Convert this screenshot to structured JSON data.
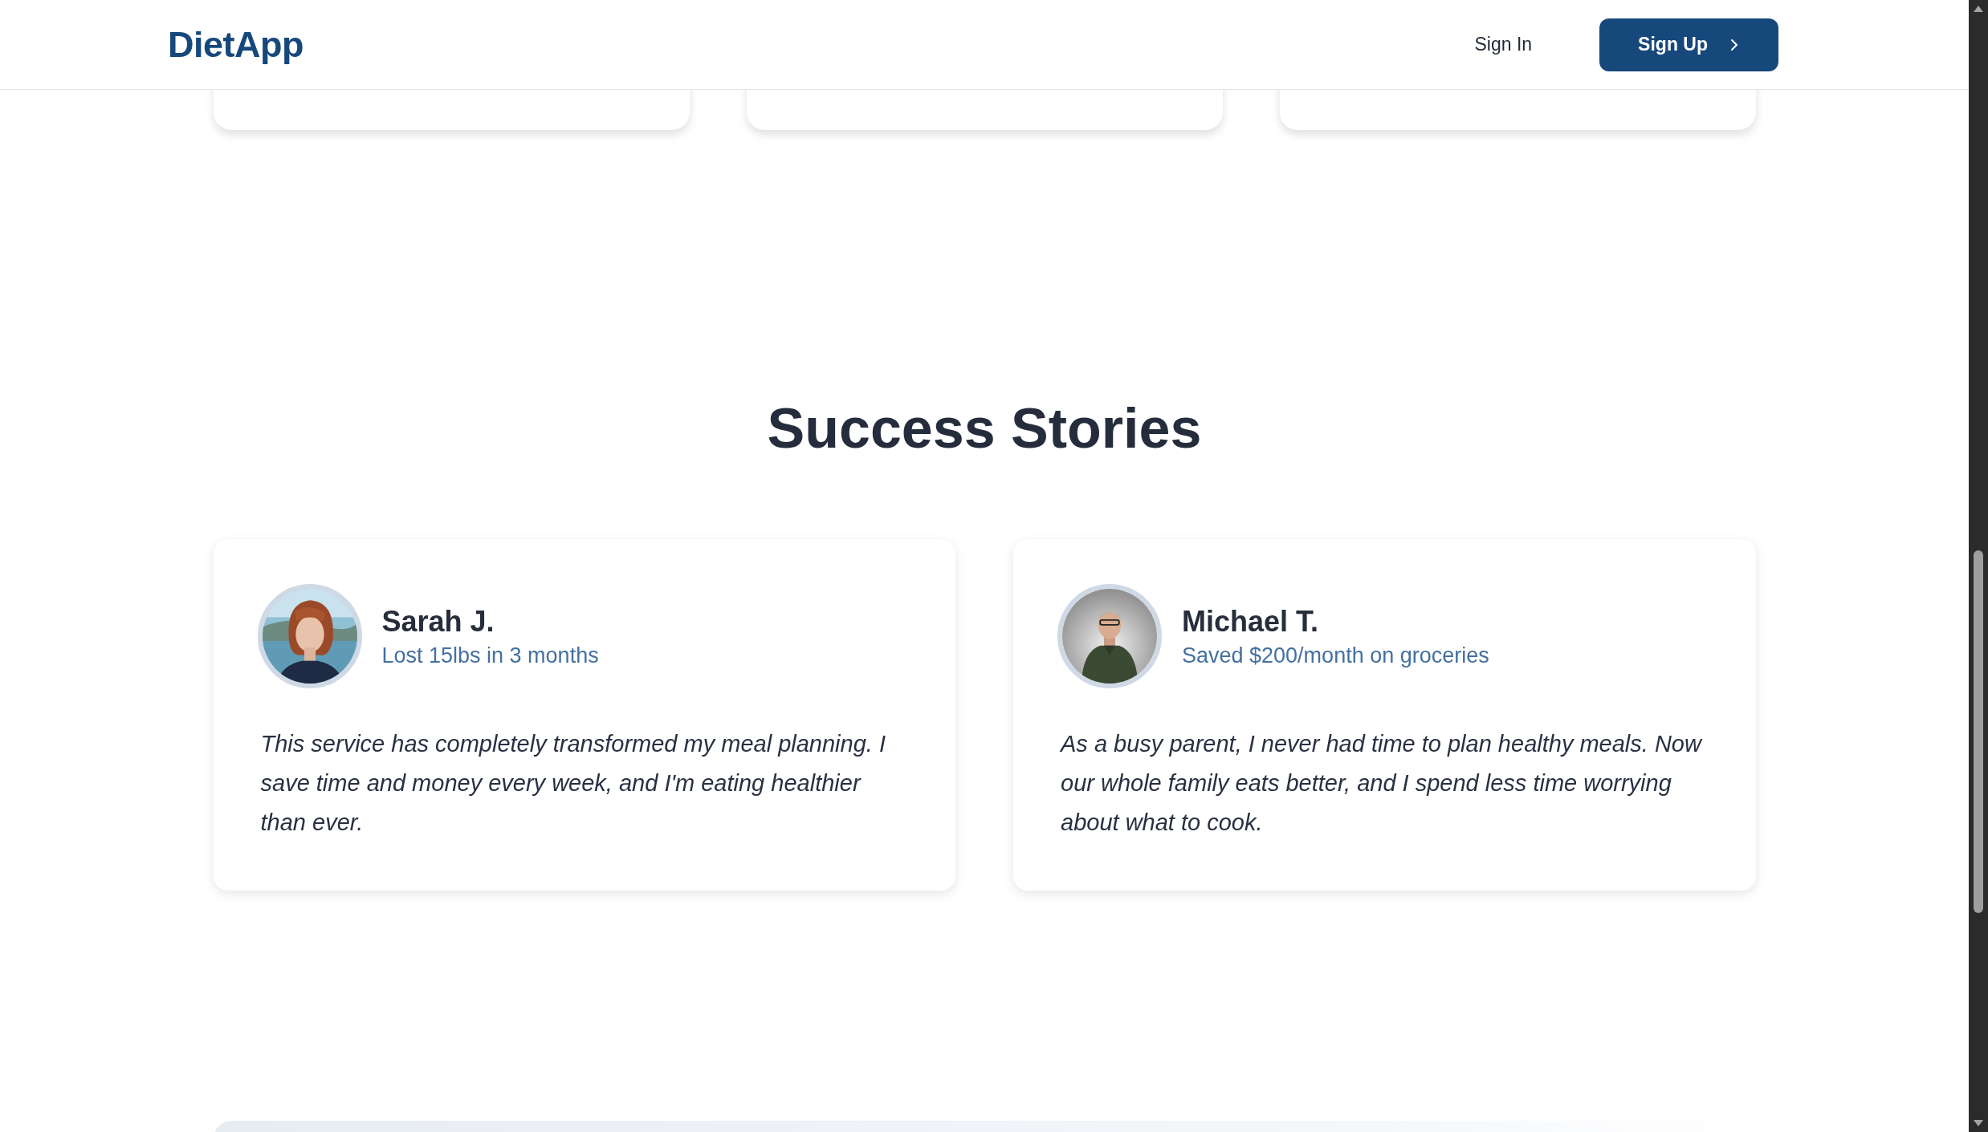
{
  "header": {
    "logo": "DietApp",
    "sign_in": "Sign In",
    "sign_up": "Sign Up"
  },
  "testimonials": {
    "title": "Success Stories",
    "items": [
      {
        "name": "Sarah J.",
        "result": "Lost 15lbs in 3 months",
        "quote": "This service has completely transformed my meal planning. I save time and money every week, and I'm eating healthier than ever."
      },
      {
        "name": "Michael T.",
        "result": "Saved $200/month on groceries",
        "quote": "As a busy parent, I never had time to plan healthy meals. Now our whole family eats better, and I spend less time worrying about what to cook."
      }
    ]
  }
}
